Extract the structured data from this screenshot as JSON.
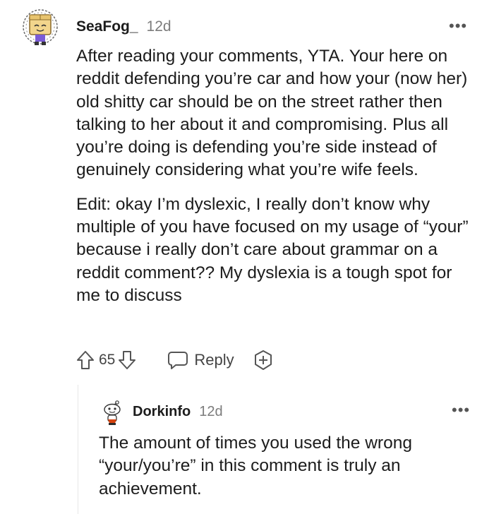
{
  "comments": [
    {
      "username": "SeaFog_",
      "age": "12d",
      "more_label": "•••",
      "paragraphs": [
        "After reading your comments, YTA. Your here on reddit defending you’re car and how your (now her) old shitty car should be on the street rather then talking to her about it and compromising. Plus all you’re doing is defending you’re side instead of genuinely considering what you’re wife feels.",
        "Edit: okay I’m dyslexic, I really don’t know why multiple of you have focused on my usage of “your” because i really don’t care about grammar on a reddit comment?? My dyslexia is a tough spot for me to discuss"
      ],
      "votes": "65",
      "reply_label": "Reply"
    },
    {
      "username": "Dorkinfo",
      "age": "12d",
      "more_label": "•••",
      "paragraphs": [
        "The amount of times you used the wrong “your/you’re” in this comment is truly an achievement."
      ]
    }
  ],
  "icons": {
    "upvote": "upvote-arrow-icon",
    "downvote": "downvote-arrow-icon",
    "reply": "speech-bubble-icon",
    "award": "award-plus-icon",
    "more": "more-dots-icon"
  },
  "colors": {
    "text": "#1c1c1c",
    "meta": "#7c7c7c",
    "icon": "#555555"
  }
}
